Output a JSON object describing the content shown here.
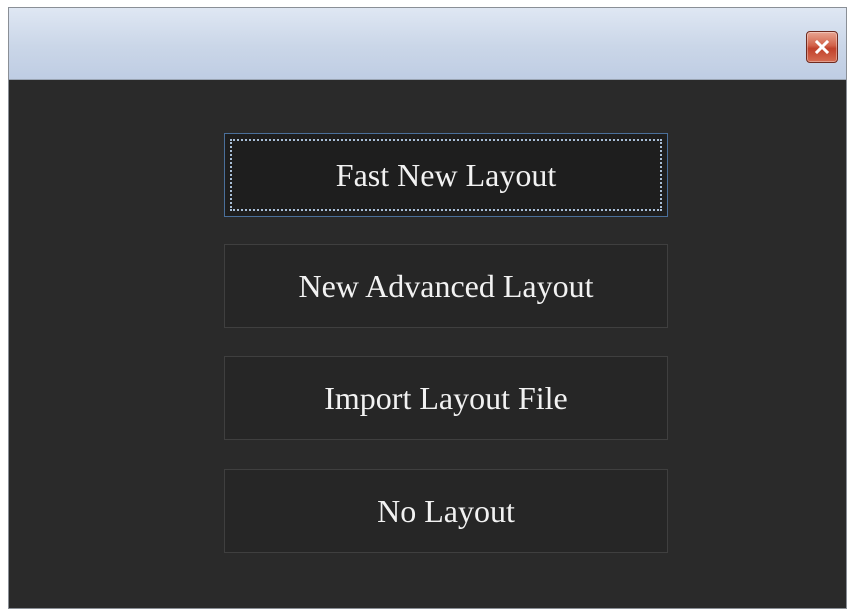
{
  "window": {
    "close_icon": "close-icon",
    "accent_close": "#c9472f",
    "focus_border": "#4a6f9a"
  },
  "options": [
    {
      "label": "Fast New Layout",
      "focused": true
    },
    {
      "label": "New Advanced Layout",
      "focused": false
    },
    {
      "label": "Import Layout File",
      "focused": false
    },
    {
      "label": "No Layout",
      "focused": false
    }
  ]
}
